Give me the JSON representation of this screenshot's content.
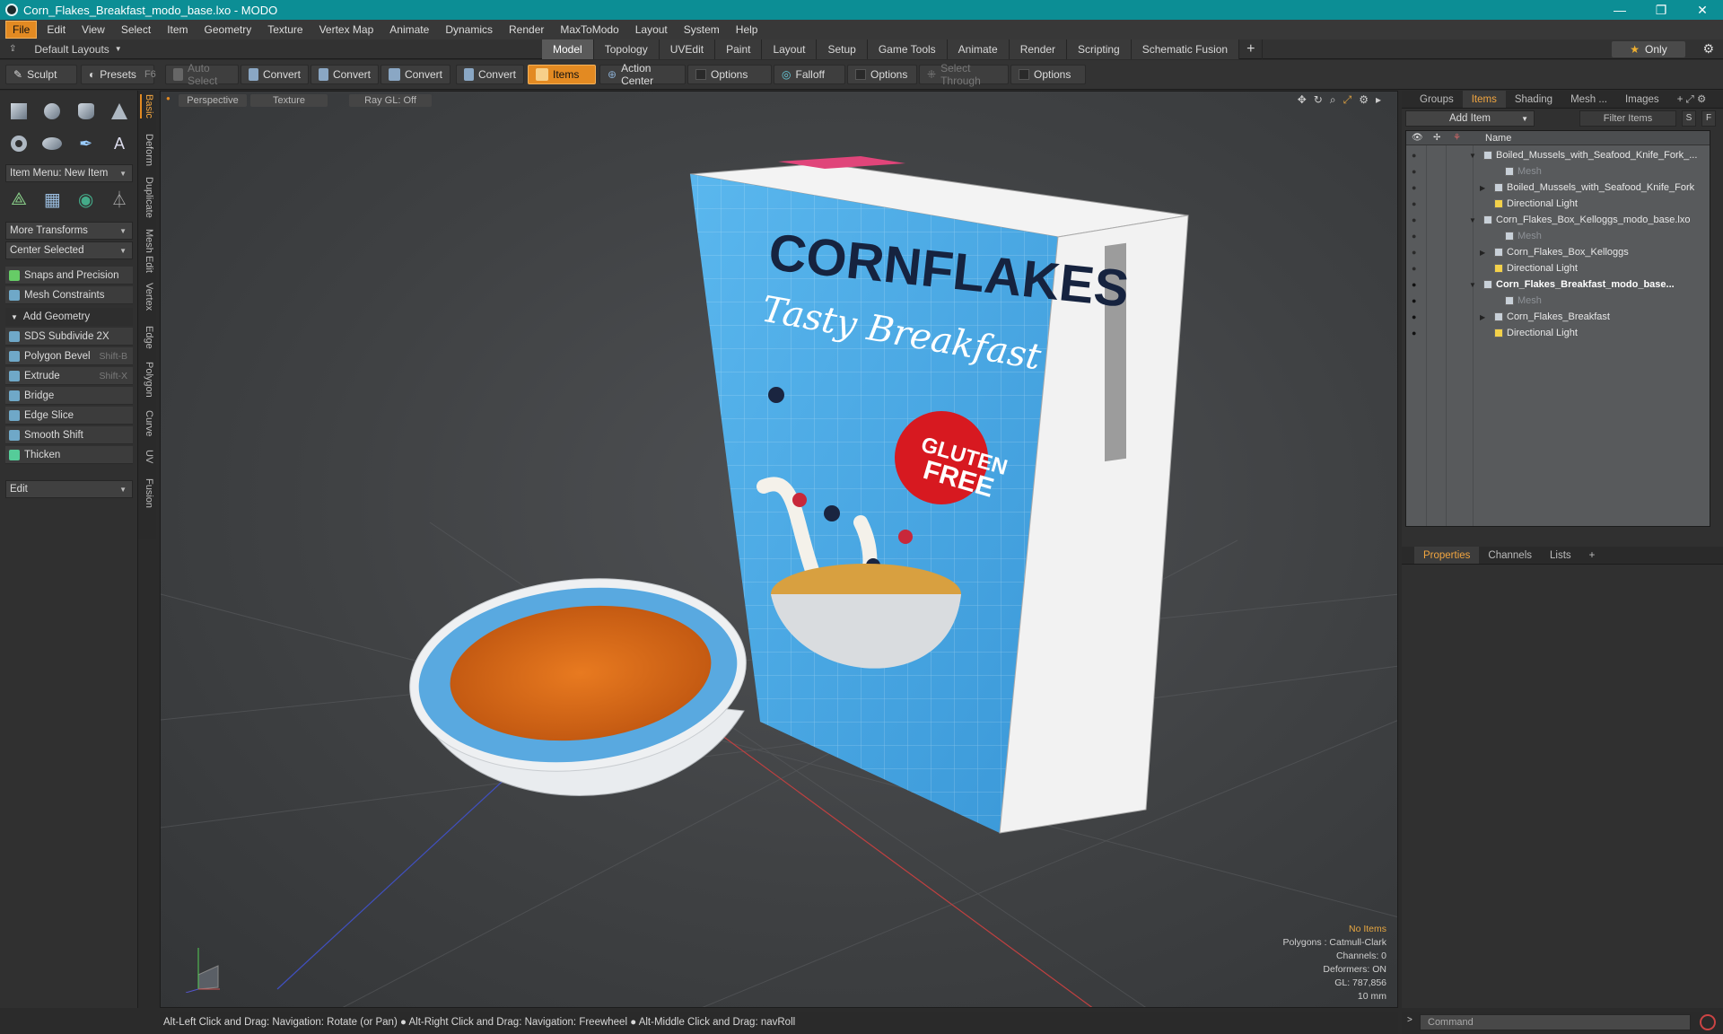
{
  "window": {
    "title": "Corn_Flakes_Breakfast_modo_base.lxo - MODO",
    "controls": [
      "—",
      "❐",
      "✕"
    ]
  },
  "menu": [
    "File",
    "Edit",
    "View",
    "Select",
    "Item",
    "Geometry",
    "Texture",
    "Vertex Map",
    "Animate",
    "Dynamics",
    "Render",
    "MaxToModo",
    "Layout",
    "System",
    "Help"
  ],
  "layoutbar": {
    "default_layouts": "Default Layouts",
    "tabs": [
      "Model",
      "Topology",
      "UVEdit",
      "Paint",
      "Layout",
      "Setup",
      "Game Tools",
      "Animate",
      "Render",
      "Scripting",
      "Schematic Fusion"
    ],
    "active_tab": "Model",
    "only_label": "Only"
  },
  "toolbar": {
    "sculpt": "Sculpt",
    "presets": "Presets",
    "presets_key": "F6",
    "auto_select": "Auto Select",
    "convert": "Convert",
    "items": "Items",
    "action_center": "Action Center",
    "options": "Options",
    "falloff": "Falloff",
    "select_through": "Select Through"
  },
  "leftpanel": {
    "item_menu": "Item Menu: New Item",
    "more_transforms": "More Transforms",
    "center_selected": "Center Selected",
    "snaps": "Snaps and Precision",
    "mesh_constraints": "Mesh Constraints",
    "add_geometry": "Add Geometry",
    "tools": [
      {
        "label": "SDS Subdivide 2X",
        "key": ""
      },
      {
        "label": "Polygon Bevel",
        "key": "Shift-B"
      },
      {
        "label": "Extrude",
        "key": "Shift-X"
      },
      {
        "label": "Bridge",
        "key": ""
      },
      {
        "label": "Edge Slice",
        "key": ""
      },
      {
        "label": "Smooth Shift",
        "key": ""
      },
      {
        "label": "Thicken",
        "key": ""
      }
    ],
    "edit": "Edit",
    "sidetabs": [
      "Basic",
      "Deform",
      "Duplicate",
      "Mesh Edit",
      "Vertex",
      "Edge",
      "Polygon",
      "Curve",
      "UV",
      "Fusion"
    ]
  },
  "viewport": {
    "perspective": "Perspective",
    "texture": "Texture",
    "raygl": "Ray GL: Off",
    "info": {
      "no_items": "No Items",
      "polygons": "Polygons : Catmull-Clark",
      "channels": "Channels: 0",
      "deformers": "Deformers: ON",
      "gl": "GL: 787,856",
      "scale": "10 mm"
    },
    "box": {
      "title": "CORNFLAKES",
      "subtitle": "Tasty Breakfast",
      "badge_line1": "GLUTEN",
      "badge_line2": "FREE"
    }
  },
  "rightpanel": {
    "tabs": [
      "Groups",
      "Items",
      "Shading",
      "Mesh ...",
      "Images"
    ],
    "active_tab": "Items",
    "add_item": "Add Item",
    "filter_items": "Filter Items",
    "s": "S",
    "f": "F",
    "name_col": "Name",
    "tree": [
      {
        "label": "Boiled_Mussels_with_Seafood_Knife_Fork_...",
        "indent": 0,
        "kind": "scene",
        "expander": "▼",
        "eye": false
      },
      {
        "label": "Mesh",
        "indent": 2,
        "kind": "mesh-dim",
        "expander": "",
        "eye": false
      },
      {
        "label": "Boiled_Mussels_with_Seafood_Knife_Fork",
        "indent": 1,
        "kind": "group",
        "expander": "▶",
        "eye": false
      },
      {
        "label": "Directional Light",
        "indent": 1,
        "kind": "light",
        "expander": "",
        "eye": false
      },
      {
        "label": "Corn_Flakes_Box_Kelloggs_modo_base.lxo",
        "indent": 0,
        "kind": "scene",
        "expander": "▼",
        "eye": false
      },
      {
        "label": "Mesh",
        "indent": 2,
        "kind": "mesh-dim",
        "expander": "",
        "eye": false
      },
      {
        "label": "Corn_Flakes_Box_Kelloggs",
        "indent": 1,
        "kind": "group",
        "expander": "▶",
        "eye": false
      },
      {
        "label": "Directional Light",
        "indent": 1,
        "kind": "light",
        "expander": "",
        "eye": false
      },
      {
        "label": "Corn_Flakes_Breakfast_modo_base...",
        "indent": 0,
        "kind": "scene-bold",
        "expander": "▼",
        "eye": true
      },
      {
        "label": "Mesh",
        "indent": 2,
        "kind": "mesh-dim",
        "expander": "",
        "eye": true
      },
      {
        "label": "Corn_Flakes_Breakfast",
        "indent": 1,
        "kind": "group",
        "expander": "▶",
        "eye": true
      },
      {
        "label": "Directional Light",
        "indent": 1,
        "kind": "light",
        "expander": "",
        "eye": true
      }
    ],
    "prop_tabs": [
      "Properties",
      "Channels",
      "Lists"
    ],
    "prop_active": "Properties"
  },
  "status": "Alt-Left Click and Drag: Navigation: Rotate (or Pan) ● Alt-Right Click and Drag: Navigation: Freewheel ● Alt-Middle Click and Drag: navRoll",
  "command_placeholder": "Command",
  "colors": {
    "accent": "#e38a22",
    "titlebar": "#0c8e95",
    "box_blue": "#4aa8e4",
    "badge_red": "#d71920"
  }
}
